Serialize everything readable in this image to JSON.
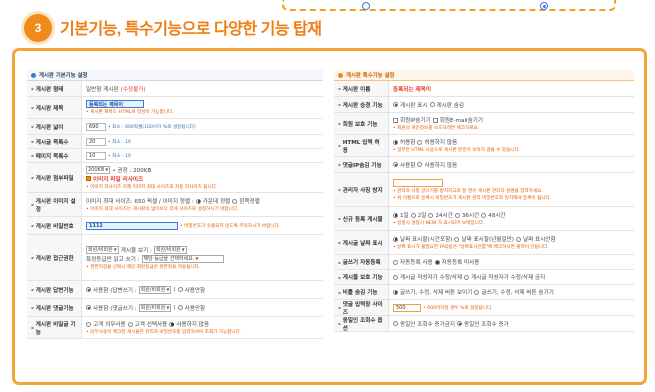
{
  "section": {
    "number": "3",
    "title": "기본기능, 특수기능으로 다양한 기능 탑재"
  },
  "left": {
    "title": "게시판 기본기능 설정",
    "rows": [
      {
        "label": "게시판 형태",
        "value": "일반형 게시판",
        "extra": "(수정불가)"
      },
      {
        "label": "게시판 제목",
        "input": "등록되는 제목이",
        "note": "• 게시판 제목도 HTML로 작성이 가능합니다."
      },
      {
        "label": "게시판 넓이",
        "input": "690",
        "unit": "• 최소 : 600픽셀(100이하 %로 설정됩니다)"
      },
      {
        "label": "게시글 목록수",
        "input": "20",
        "unit": "• 최소 : 10"
      },
      {
        "label": "페이지 목록수",
        "input": "10",
        "unit": "• 최소 : 10"
      },
      {
        "label": "게시판 첨부파일",
        "select": "200KB",
        "unit": "• 권장 : 200KB",
        "check": "이미지 파일 리사이즈",
        "note": "• 이미지 리사이즈 이제 이미지 최대 사이즈로 자동 리사이즈 됩니다."
      },
      {
        "label": "게시판 이미지 설정",
        "line": "이미지 최대 사이즈: 650  픽셀 / 이미지 정렬 :",
        "opt1": "가운데 정렬",
        "opt2": "왼쪽정렬",
        "note": "• 이미지 최대 사이즈는 게시판의 넓이보다 작게 사이즈로 설정하시기 바랍니다."
      },
      {
        "label": "게시판 비밀번호",
        "input": "1111",
        "note": "• 비밀번호가 유출되지 않도록 주의하시기 바랍니다."
      },
      {
        "label": "게시판 접근권한",
        "sel1": "회원/비회원",
        "mid": "게시물 보기 :",
        "sel2": "회원/비회원",
        "prefix": "특정등급만 읽고 쓰기 :",
        "sel3": "해당 등급을 선택하세요.",
        "note": "• 권한지정을 선택시 해당 회원등급은 권한정을 적용됩니다."
      },
      {
        "label": "게시판 답변기능",
        "opt1": "사용함 (답변쓰기 :",
        "sel": "회원/비회원",
        "opt2": "사용안함"
      },
      {
        "label": "게시판 댓글기능",
        "opt1": "사용함 (댓글쓰기 :",
        "sel": "회원/비회원",
        "opt2": "사용안함"
      },
      {
        "label": "게시판 비밀글 기능",
        "opt1": "고객 의무사용",
        "opt2": "고객 선택사용",
        "opt3": "사용하지 않음",
        "note": "• 의무사용이 체크된 게시물은 관리자 비밀번호를 입력하셔야 조회가 가능합니다."
      }
    ]
  },
  "right": {
    "title": "게시판 특수기능 설정",
    "rows": [
      {
        "label": "게시판 이름",
        "value": "등록되는 제목이"
      },
      {
        "label": "게시판 승경 기능",
        "opt1": "게시판 표시",
        "opt2": "게시판 숨김"
      },
      {
        "label": "회원 보호 기능",
        "chk1": "회원IP숨기기",
        "chk2": "회원E-mail숨기기",
        "note": "• 회원의 개인정보를 보호하려면 체크하세요."
      },
      {
        "label": "HTML 입력 허용",
        "opt1": "허용함",
        "opt2": "허용하지 않음",
        "note": "• 일부만 HTML 사용으로 게시판 본문이 보이지 않을 수 있습니다."
      },
      {
        "label": "댓글IP숨김 기능",
        "opt1": "사용함",
        "opt2": "사용하지 않음"
      },
      {
        "label": "관리자 사칭 방지",
        "note": "• 관리자 사칭 글쓰기를 방지하고자 할 경우 게시판 관리자 성명을 입력하세요.",
        "note2": "• 위 이름으로 등록시 비밀번호가 게시판 관리 비밀번호와 일치해야 등록이 됩니다."
      },
      {
        "label": "신규 등록 게시물",
        "opt1": "1일",
        "opt2": "2일",
        "opt3": "24시간",
        "opt4": "36시간",
        "opt5": "48시간",
        "note": "• 일정시 설정시 NEW 가 표시되어 보여집니다."
      },
      {
        "label": "게시글 날짜 표시",
        "opt1": "날짜 표시할(시간포함)",
        "opt2": "날짜 표시할(년월일만)",
        "opt3": "날짜 표시안함",
        "note": "• 날짜 표시가 불필요한 FAQ등은 \"날짜표시안함\"에 체크하시면 출력이 안됩니다."
      },
      {
        "label": "글쓰기 자동등록",
        "opt1": "자동등록 사용",
        "opt2": "자동등록 미사용"
      },
      {
        "label": "게시물 보호 기능",
        "opt1": "게시글 작성자가 수정/삭제",
        "opt2": "게시글 작성자가 수정/삭제 금지"
      },
      {
        "label": "비틀 숨김 기능",
        "opt1": "글쓰기, 수정, 삭제 버튼 보이기",
        "opt2": "글쓰기, 수정, 삭제 버튼 숨기기"
      },
      {
        "label": "댓글 입력창 사이즈",
        "input": "500",
        "unit": "• 600이하일 경우 %로 설정됩니다."
      },
      {
        "label": "동일인 조회수 옵션",
        "opt1": "동일인 조회수 증가금지",
        "opt2": "동일인 조회수 증가"
      }
    ]
  }
}
